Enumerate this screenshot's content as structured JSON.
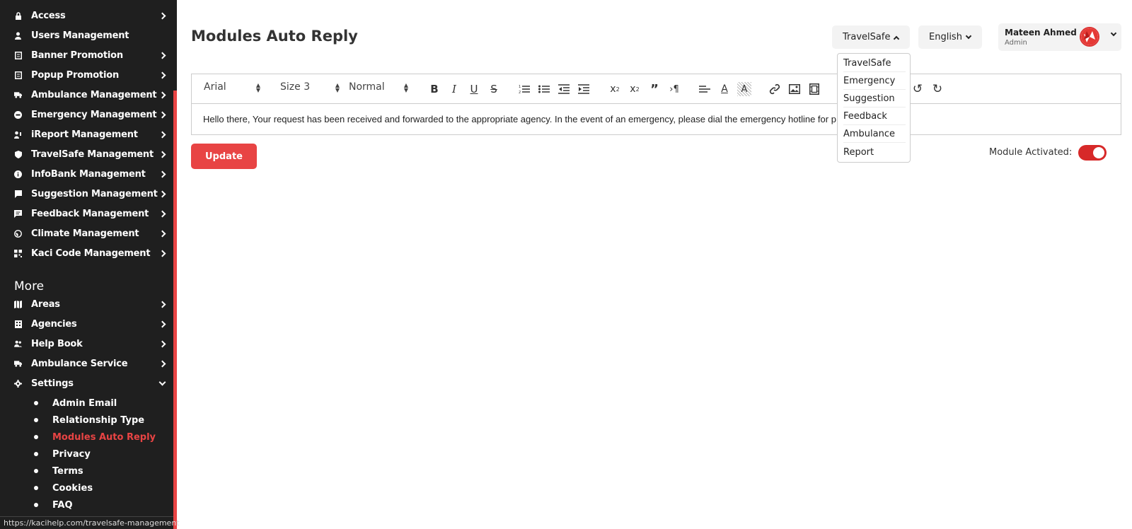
{
  "sidebar": {
    "items": [
      {
        "label": "Access",
        "icon": "lock-icon",
        "chevron": true
      },
      {
        "label": "Users Management",
        "icon": "user-icon",
        "chevron": false
      },
      {
        "label": "Banner Promotion",
        "icon": "document-icon",
        "chevron": true
      },
      {
        "label": "Popup Promotion",
        "icon": "document-icon",
        "chevron": true
      },
      {
        "label": "Ambulance Management",
        "icon": "ambulance-icon",
        "chevron": true
      },
      {
        "label": "Emergency Management",
        "icon": "emergency-icon",
        "chevron": true
      },
      {
        "label": "iReport Management",
        "icon": "report-icon",
        "chevron": true
      },
      {
        "label": "TravelSafe Management",
        "icon": "shield-icon",
        "chevron": true
      },
      {
        "label": "InfoBank Management",
        "icon": "info-icon",
        "chevron": true
      },
      {
        "label": "Suggestion Management",
        "icon": "suggestion-icon",
        "chevron": true
      },
      {
        "label": "Feedback Management",
        "icon": "feedback-icon",
        "chevron": true
      },
      {
        "label": "Climate Management",
        "icon": "globe-icon",
        "chevron": true
      },
      {
        "label": "Kaci Code Management",
        "icon": "code-icon",
        "chevron": true
      }
    ],
    "more_heading": "More",
    "more_items": [
      {
        "label": "Areas",
        "icon": "map-icon",
        "chevron": "right"
      },
      {
        "label": "Agencies",
        "icon": "building-icon",
        "chevron": "right"
      },
      {
        "label": "Help Book",
        "icon": "people-icon",
        "chevron": "right"
      },
      {
        "label": "Ambulance Service",
        "icon": "ambulance-icon",
        "chevron": "right"
      },
      {
        "label": "Settings",
        "icon": "gear-icon",
        "chevron": "down"
      }
    ],
    "settings_sub": [
      {
        "label": "Admin Email",
        "active": false
      },
      {
        "label": "Relationship Type",
        "active": false
      },
      {
        "label": "Modules Auto Reply",
        "active": true
      },
      {
        "label": "Privacy",
        "active": false
      },
      {
        "label": "Terms",
        "active": false
      },
      {
        "label": "Cookies",
        "active": false
      },
      {
        "label": "FAQ",
        "active": false
      }
    ],
    "status_url": "https://kacihelp.com/travelsafe-management"
  },
  "header": {
    "title": "Modules Auto Reply",
    "module_select": "TravelSafe",
    "language_select": "English",
    "user_name": "Mateen Ahmed",
    "user_role": "Admin"
  },
  "module_menu": {
    "options": [
      "TravelSafe",
      "Emergency",
      "Suggestion",
      "Feedback",
      "Ambulance",
      "Report"
    ]
  },
  "editor": {
    "font": "Arial",
    "size": "Size 3",
    "style": "Normal",
    "content": "Hello there, Your request has been received and forwarded to the appropriate agency. In the event of an emergency, please dial the emergency hotline for p"
  },
  "actions": {
    "update_label": "Update",
    "module_activated_label": "Module Activated:",
    "module_activated": true
  },
  "colors": {
    "accent": "#e84444",
    "sidebar_bg": "#1f1f1f",
    "toggle_on": "#d72929"
  }
}
